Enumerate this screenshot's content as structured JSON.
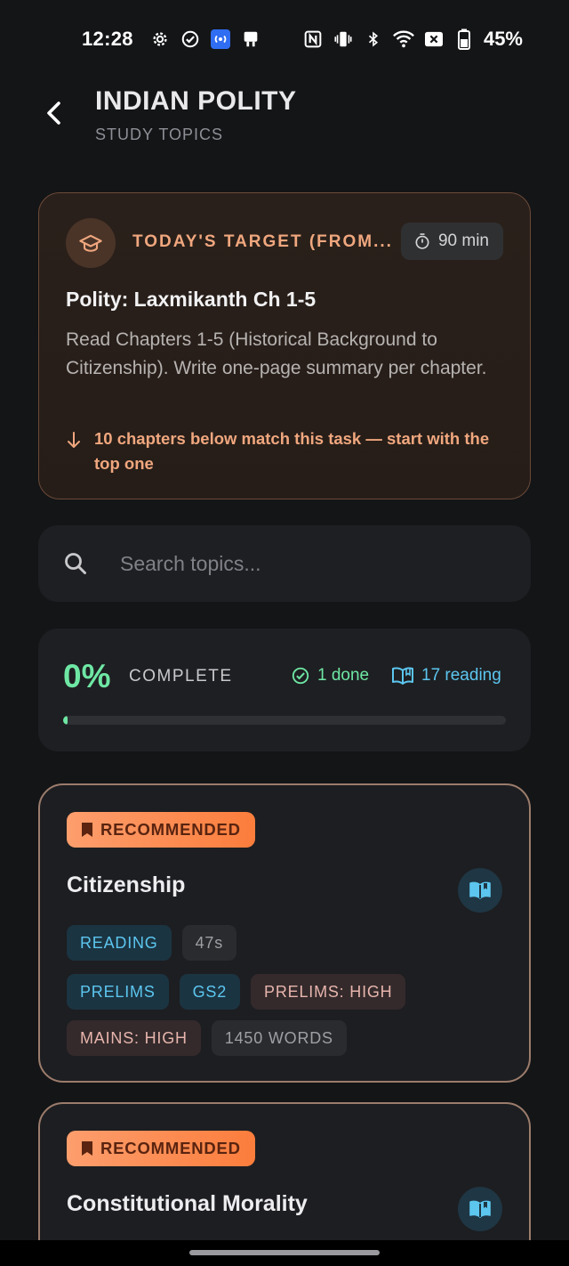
{
  "status_bar": {
    "time": "12:28",
    "battery_percent": "45%",
    "icons_left": [
      "gear-icon",
      "check-circle-icon",
      "hotspot-icon",
      "cast-icon"
    ],
    "icons_right": [
      "nfc-icon",
      "vibrate-icon",
      "bluetooth-icon",
      "wifi-icon",
      "no-sim-icon",
      "battery-icon"
    ]
  },
  "header": {
    "title": "INDIAN POLITY",
    "subtitle": "STUDY TOPICS"
  },
  "target": {
    "label": "TODAY'S TARGET (FROM...",
    "duration": "90 min",
    "title": "Polity: Laxmikanth Ch 1-5",
    "description": "Read Chapters 1-5 (Historical Background to Citizenship). Write one-page summary per chapter.",
    "hint": "10 chapters below match this task — start with the top one"
  },
  "search": {
    "placeholder": "Search topics..."
  },
  "progress": {
    "percent": "0%",
    "label": "COMPLETE",
    "done": "1 done",
    "reading": "17 reading",
    "fill_fraction": 0.01
  },
  "topics": [
    {
      "badge": "RECOMMENDED",
      "title": "Citizenship",
      "chips_row1": [
        "READING",
        "47s"
      ],
      "chips_row2": [
        "PRELIMS",
        "GS2",
        "PRELIMS: HIGH"
      ],
      "chips_row3": [
        "MAINS: HIGH",
        "1450 WORDS"
      ]
    },
    {
      "badge": "RECOMMENDED",
      "title": "Constitutional Morality"
    }
  ],
  "colors": {
    "accent_orange": "#f0a77e",
    "accent_green": "#6ee7a4",
    "accent_blue": "#5cc6ef",
    "background": "#141517"
  }
}
